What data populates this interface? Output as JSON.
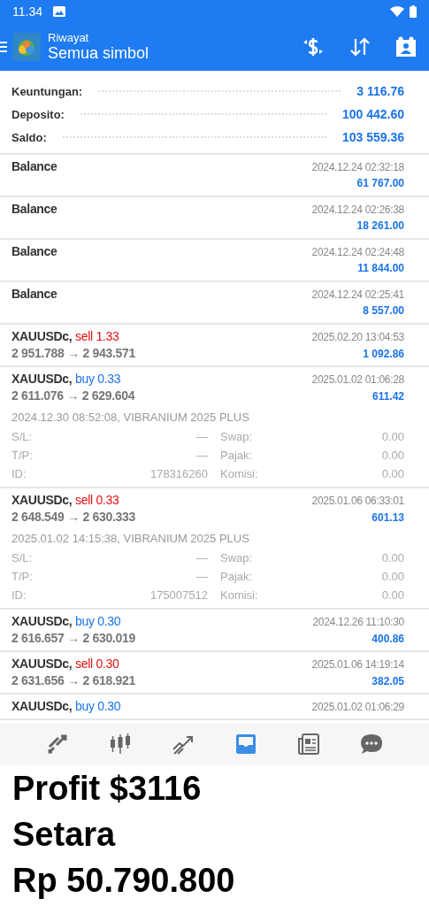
{
  "status_bar": {
    "time": "11.34"
  },
  "toolbar": {
    "subtitle": "Riwayat",
    "title": "Semua simbol"
  },
  "summary": [
    {
      "label": "Keuntungan:",
      "value": "3 116.76"
    },
    {
      "label": "Deposito:",
      "value": "100 442.60"
    },
    {
      "label": "Saldo:",
      "value": "103 559.36"
    }
  ],
  "rows": [
    {
      "kind": "balance",
      "title": "Balance",
      "time": "2024.12.24 02:32:18",
      "amount": "61 767.00"
    },
    {
      "kind": "balance",
      "title": "Balance",
      "time": "2024.12.24 02:26:38",
      "amount": "18 261.00"
    },
    {
      "kind": "balance",
      "title": "Balance",
      "time": "2024.12.24 02:24:48",
      "amount": "11 844.00"
    },
    {
      "kind": "balance",
      "title": "Balance",
      "time": "2024.12.24 02:25:41",
      "amount": "8 557.00"
    },
    {
      "kind": "trade",
      "symbol": "XAUUSDc,",
      "color": "#e01010",
      "order": "sell 1.33",
      "prices": "2 951.788 → 2 943.571",
      "time": "2025.02.20 13:04:53",
      "amount": "1 092.86",
      "expanded": false
    },
    {
      "kind": "trade",
      "symbol": "XAUUSDc,",
      "color": "#1a73e8",
      "order": "buy 0.33",
      "prices": "2 611.076 → 2 629.604",
      "time": "2025.01.02 01:06:28",
      "amount": "611.42",
      "expanded": true,
      "opened": "2024.12.30 08:52:08, VIBRANIUM 2025 PLUS",
      "details": [
        {
          "label": "S/L:",
          "value": "—",
          "label2": "Swap:",
          "value2": "0.00"
        },
        {
          "label": "T/P:",
          "value": "—",
          "label2": "Pajak:",
          "value2": "0.00"
        },
        {
          "label": "ID:",
          "value": "178316260",
          "label2": "Komisi:",
          "value2": "0.00"
        }
      ]
    },
    {
      "kind": "trade",
      "symbol": "XAUUSDc,",
      "color": "#e01010",
      "order": "sell 0.33",
      "prices": "2 648.549 → 2 630.333",
      "time": "2025.01.06 06:33:01",
      "amount": "601.13",
      "expanded": true,
      "opened": "2025.01.02 14:15:38, VIBRANIUM 2025 PLUS",
      "details": [
        {
          "label": "S/L:",
          "value": "—",
          "label2": "Swap:",
          "value2": "0.00"
        },
        {
          "label": "T/P:",
          "value": "—",
          "label2": "Pajak:",
          "value2": "0.00"
        },
        {
          "label": "ID:",
          "value": "175007512",
          "label2": "Komisi:",
          "value2": "0.00"
        }
      ]
    },
    {
      "kind": "trade",
      "symbol": "XAUUSDc,",
      "color": "#1a73e8",
      "order": "buy 0.30",
      "prices": "2 616.657 → 2 630.019",
      "time": "2024.12.26 11:10:30",
      "amount": "400.86",
      "expanded": false
    },
    {
      "kind": "trade",
      "symbol": "XAUUSDc,",
      "color": "#e01010",
      "order": "sell 0.30",
      "prices": "2 631.656 → 2 618.921",
      "time": "2025.01.06 14:19:14",
      "amount": "382.05",
      "expanded": false
    },
    {
      "kind": "trade",
      "symbol": "XAUUSDc,",
      "color": "#1a73e8",
      "order": "buy 0.30",
      "time": "2025.01.02 01:06:29"
    }
  ],
  "nav": [
    {
      "selected": false
    },
    {
      "selected": false
    },
    {
      "selected": false
    },
    {
      "selected": true
    },
    {
      "selected": false
    },
    {
      "selected": false
    }
  ],
  "caption": [
    "Profit $3116",
    "Setara",
    "Rp 50.790.800"
  ]
}
